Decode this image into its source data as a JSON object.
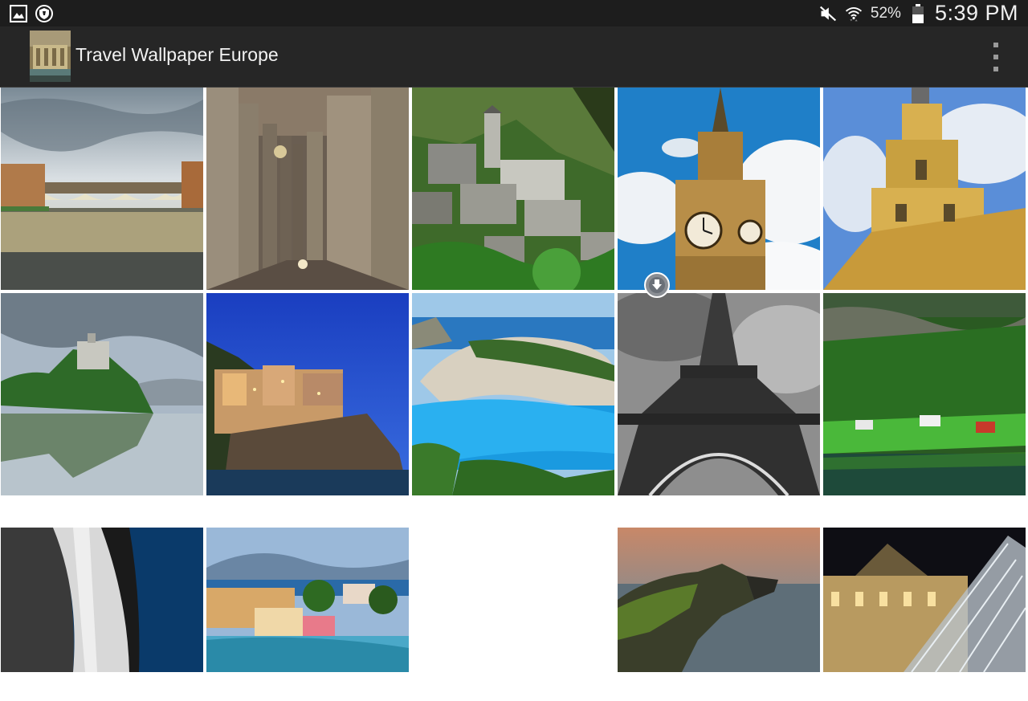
{
  "status_bar": {
    "icons_left": [
      "gallery-icon",
      "shield-icon"
    ],
    "icons_right": [
      "mute-icon",
      "wifi-icon",
      "battery-icon"
    ],
    "battery": "52%",
    "time": "5:39 PM",
    "battery_level": 0.52
  },
  "app_bar": {
    "title": "Travel Wallpaper Europe",
    "overflow_icon": "more-vert-icon"
  },
  "gallery": {
    "columns": 5,
    "items": [
      {
        "name": "florence-bridge-thumb"
      },
      {
        "name": "colonnade-thumb"
      },
      {
        "name": "mountain-village-thumb"
      },
      {
        "name": "big-ben-thumb"
      },
      {
        "name": "yellow-church-thumb"
      },
      {
        "name": "lake-castle-thumb"
      },
      {
        "name": "cinque-terre-thumb"
      },
      {
        "name": "navagio-beach-thumb"
      },
      {
        "name": "eiffel-tower-thumb"
      },
      {
        "name": "norway-fjord-thumb"
      },
      {
        "name": "waterfall-cliff-thumb"
      },
      {
        "name": "assos-harbor-thumb"
      },
      {
        "name": "loading-thumb"
      },
      {
        "name": "neist-point-thumb"
      },
      {
        "name": "louvre-thumb"
      }
    ],
    "download_icon": "download-icon"
  }
}
